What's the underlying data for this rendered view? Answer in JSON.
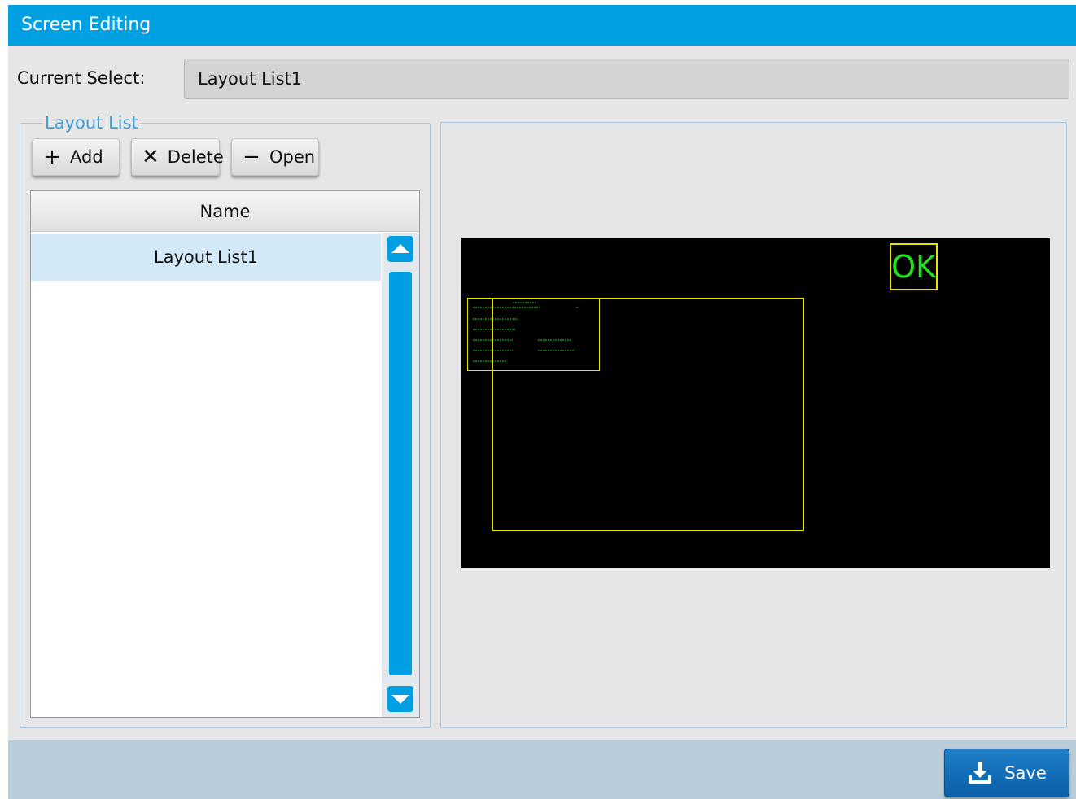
{
  "window": {
    "title": "Screen Editing"
  },
  "current_select": {
    "label": "Current Select:",
    "value": "Layout List1"
  },
  "layout_list": {
    "legend": "Layout List",
    "buttons": {
      "add": {
        "icon": "plus-icon",
        "label": "Add"
      },
      "delete": {
        "icon": "x-icon",
        "label": "Delete"
      },
      "open": {
        "icon": "minus-icon",
        "label": "Open"
      }
    },
    "table": {
      "header": "Name",
      "rows": [
        "Layout List1"
      ],
      "selected_row": 0
    }
  },
  "preview": {
    "background": "#000000",
    "accent": "#e6e600",
    "text_color": "#22e022",
    "ok_label": "OK"
  },
  "footer": {
    "save_label": "Save",
    "save_icon": "download-icon"
  },
  "colors": {
    "title_bar": "#00a0e3",
    "selection": "#d3e9f7",
    "scrollbar": "#009ee3"
  }
}
